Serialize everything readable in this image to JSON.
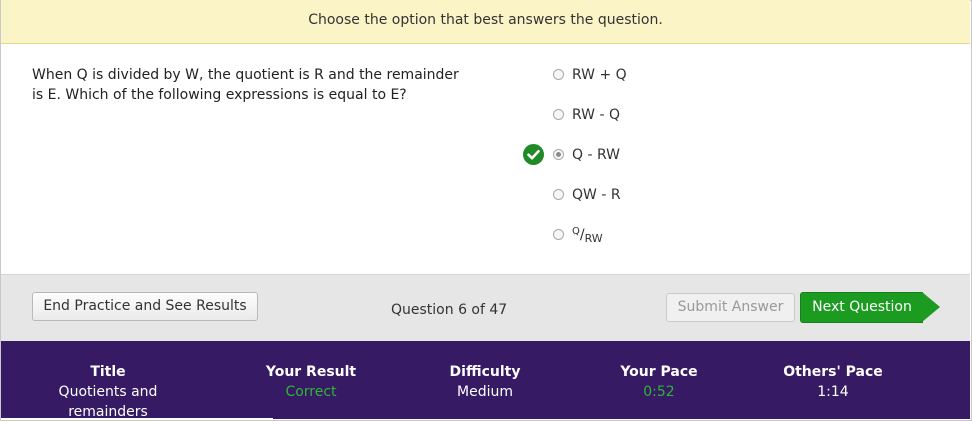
{
  "banner": {
    "instruction": "Choose the option that best answers the question."
  },
  "question": {
    "text": "When Q is divided by W, the quotient is R and the remainder is E. Which of the following expressions is equal to E?"
  },
  "choices": [
    {
      "label": "RW + Q",
      "selected": false
    },
    {
      "label": "RW - Q",
      "selected": false
    },
    {
      "label": "Q - RW",
      "selected": true,
      "correct": true
    },
    {
      "label": "QW - R",
      "selected": false
    },
    {
      "label_numerator": "Q",
      "label_slash": "/",
      "label_denominator": "RW",
      "selected": false
    }
  ],
  "toolbar": {
    "end_label": "End Practice and See Results",
    "progress": "Question 6 of 47",
    "submit_label": "Submit Answer",
    "next_label": "Next Question"
  },
  "stats": {
    "title_head": "Title",
    "title_value": "Quotients and remainders",
    "result_head": "Your Result",
    "result_value": "Correct",
    "difficulty_head": "Difficulty",
    "difficulty_value": "Medium",
    "pace_head": "Your Pace",
    "pace_value": "0:52",
    "others_head": "Others' Pace",
    "others_value": "1:14"
  },
  "colors": {
    "banner_bg": "#fbf4c7",
    "stats_bg": "#361a63",
    "next_button": "#1b9b20",
    "correct_green": "#2fb438",
    "check_icon": "#1f8a26"
  },
  "icons": {
    "correct_marker": "check-circle-icon"
  }
}
